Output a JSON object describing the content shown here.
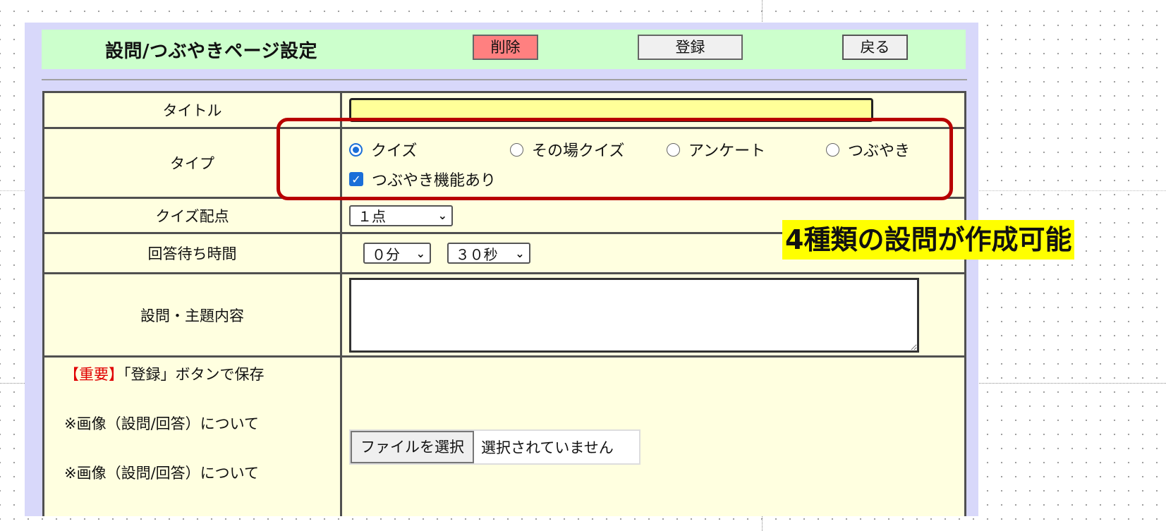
{
  "header": {
    "title": "設問/つぶやきページ設定",
    "delete_label": "削除",
    "save_label": "登録",
    "back_label": "戻る"
  },
  "form": {
    "title": {
      "label": "タイトル",
      "value": ""
    },
    "type": {
      "label": "タイプ",
      "options": [
        "クイズ",
        "その場クイズ",
        "アンケート",
        "つぶやき"
      ],
      "selected": "クイズ",
      "checkbox_label": "つぶやき機能あり",
      "checkbox_checked": true
    },
    "score": {
      "label": "クイズ配点",
      "value": "１点"
    },
    "wait_time": {
      "label": "回答待ち時間",
      "minutes": "０分",
      "seconds": "３０秒"
    },
    "content": {
      "label": "設問・主題内容",
      "value": ""
    },
    "notes": {
      "important_tag": "【重要】",
      "save_note": "「登録」ボタンで保存",
      "image_note_1": "※画像（設問/回答）について",
      "image_note_2": "※画像（設問/回答）について"
    },
    "file": {
      "button_label": "ファイルを選択",
      "status": "選択されていません"
    }
  },
  "annotation": {
    "text": "4種類の設問が作成可能",
    "border_color": "#b80000",
    "highlight_color": "#ffff00"
  },
  "colors": {
    "header_bg": "#ccffcc",
    "frame_bg": "#d8d8fa",
    "table_bg": "#ffffe0",
    "delete_bg": "#ff8080",
    "input_highlight": "#ffff99",
    "accent": "#1a6ed8"
  }
}
